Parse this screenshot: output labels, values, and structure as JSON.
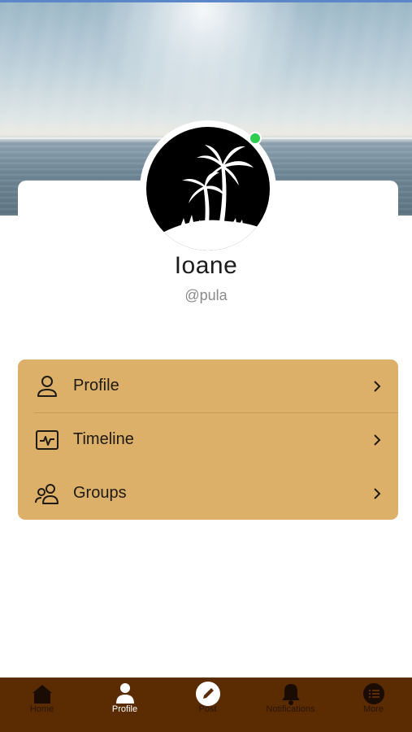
{
  "profile": {
    "name": "Ioane",
    "handle": "@pula",
    "online": true
  },
  "menu": {
    "items": [
      {
        "label": "Profile",
        "icon": "user-icon"
      },
      {
        "label": "Timeline",
        "icon": "activity-icon"
      },
      {
        "label": "Groups",
        "icon": "users-icon"
      }
    ]
  },
  "bottom_nav": {
    "items": [
      {
        "label": "Home",
        "icon": "home-icon",
        "active": false
      },
      {
        "label": "Profile",
        "icon": "user-icon",
        "active": true
      },
      {
        "label": "Post",
        "icon": "pencil-icon",
        "active": false
      },
      {
        "label": "Notifications",
        "icon": "bell-icon",
        "active": false
      },
      {
        "label": "More",
        "icon": "list-icon",
        "active": false
      }
    ]
  },
  "colors": {
    "menu_background": "#ddb06a",
    "nav_background": "#5b2c02",
    "online_dot": "#2ecc4f"
  }
}
